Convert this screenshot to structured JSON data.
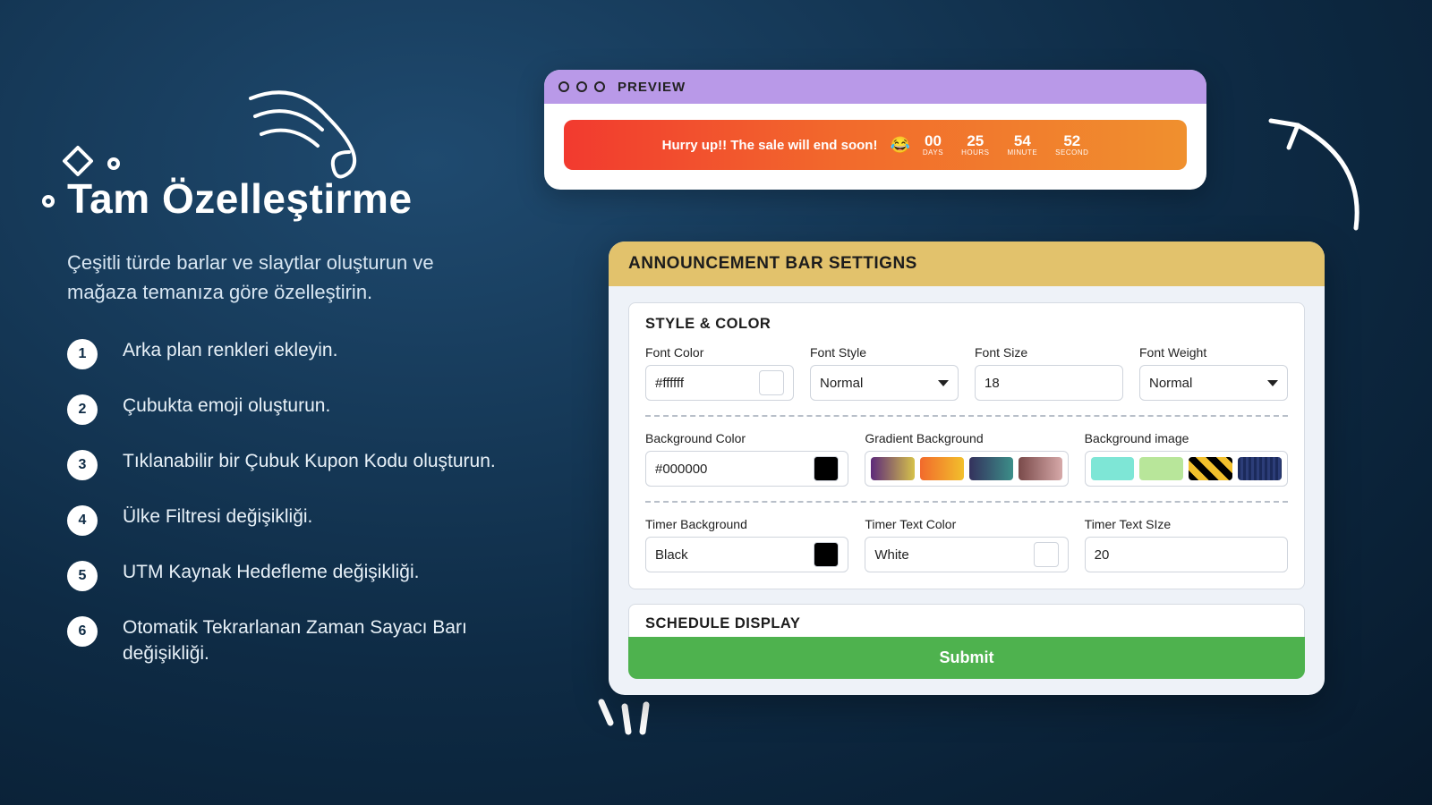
{
  "left": {
    "title": "Tam Özelleştirme",
    "subtitle": "Çeşitli türde barlar ve slaytlar oluşturun ve mağaza temanıza göre özelleştirin.",
    "items": [
      "Arka plan renkleri ekleyin.",
      "Çubukta emoji oluşturun.",
      "Tıklanabilir bir Çubuk Kupon Kodu oluşturun.",
      "Ülke Filtresi değişikliği.",
      "UTM Kaynak Hedefleme değişikliği.",
      "Otomatik Tekrarlanan Zaman Sayacı Barı değişikliği."
    ]
  },
  "preview": {
    "label": "PREVIEW",
    "message": "Hurry up!! The sale will end soon!",
    "emoji": "😂",
    "timer": [
      {
        "num": "00",
        "lbl": "DAYS"
      },
      {
        "num": "25",
        "lbl": "HOURS"
      },
      {
        "num": "54",
        "lbl": "MINUTE"
      },
      {
        "num": "52",
        "lbl": "SECOND"
      }
    ]
  },
  "settings": {
    "title": "ANNOUNCEMENT BAR SETTIGNS",
    "section1_title": "STYLE & COLOR",
    "schedule_title": "SCHEDULE DISPLAY",
    "submit": "Submit",
    "fields": {
      "font_color": {
        "label": "Font Color",
        "value": "#ffffff",
        "swatch": "#ffffff"
      },
      "font_style": {
        "label": "Font Style",
        "value": "Normal"
      },
      "font_size": {
        "label": "Font Size",
        "value": "18"
      },
      "font_weight": {
        "label": "Font Weight",
        "value": "Normal"
      },
      "bg_color": {
        "label": "Background Color",
        "value": "#000000",
        "swatch": "#000000"
      },
      "grad_bg": {
        "label": "Gradient Background"
      },
      "bg_image": {
        "label": "Background image"
      },
      "timer_bg": {
        "label": "Timer Background",
        "value": "Black",
        "swatch": "#000000"
      },
      "timer_txt": {
        "label": "Timer Text Color",
        "value": "White",
        "swatch": "#ffffff"
      },
      "timer_size": {
        "label": "Timer Text SIze",
        "value": "20"
      }
    },
    "gradients": [
      "linear-gradient(90deg,#5d2a7a,#d6c24a)",
      "linear-gradient(90deg,#f26a2c,#f2c02c)",
      "linear-gradient(90deg,#34315d,#3c8f89)",
      "linear-gradient(90deg,#7a4a4a,#d6a9a9)"
    ],
    "bg_images": [
      "linear-gradient(90deg,#7ee6d6,#7ee6d6)",
      "linear-gradient(90deg,#b8e69a,#b8e69a)",
      "repeating-linear-gradient(45deg,#000 0 8px,#f2c02c 8px 16px)",
      "repeating-linear-gradient(90deg,#1b2a5b 0 3px,#2c3d78 3px 6px)"
    ]
  }
}
